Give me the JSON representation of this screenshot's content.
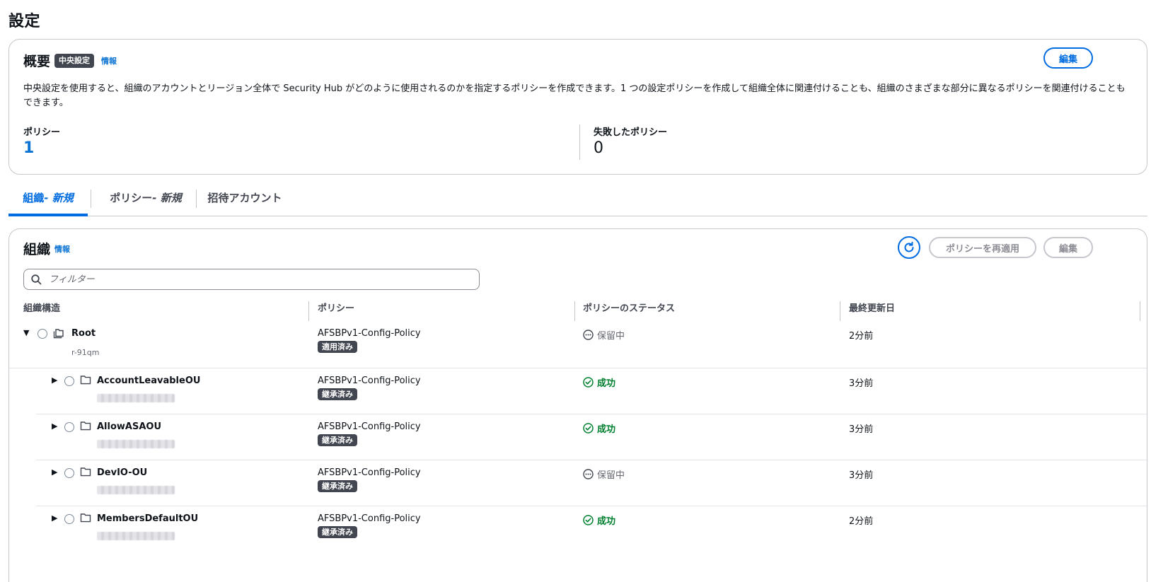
{
  "page": {
    "title": "設定"
  },
  "overview": {
    "title": "概要",
    "badge": "中央設定",
    "info": "情報",
    "edit_label": "編集",
    "description": "中央設定を使用すると、組織のアカウントとリージョン全体で Security Hub がどのように使用されるのかを指定するポリシーを作成できます。1 つの設定ポリシーを作成して組織全体に関連付けることも、組織のさまざまな部分に異なるポリシーを関連付けることもできます。",
    "metrics": [
      {
        "label": "ポリシー",
        "value": "1"
      },
      {
        "label": "失敗したポリシー",
        "value": "0"
      }
    ]
  },
  "tabs": [
    {
      "label": "組織",
      "suffix": "- 新規"
    },
    {
      "label": "ポリシー",
      "suffix": "- 新規"
    },
    {
      "label": "招待アカウント",
      "suffix": ""
    }
  ],
  "org": {
    "title": "組織",
    "info": "情報",
    "reapply_label": "ポリシーを再適用",
    "edit_label": "編集",
    "filter_placeholder": "フィルター",
    "columns": [
      "組織構造",
      "ポリシー",
      "ポリシーのステータス",
      "最終更新日"
    ],
    "rows": [
      {
        "name": "Root",
        "sub": "r-91qm",
        "policy": "AFSBPv1-Config-Policy",
        "tag": "適用済み",
        "status": "保留中",
        "status_kind": "pending",
        "updated": "2分前",
        "expanded": "▼",
        "icon": "org-units-icon"
      },
      {
        "name": "AccountLeavableOU",
        "sub": "",
        "policy": "AFSBPv1-Config-Policy",
        "tag": "継承済み",
        "status": "成功",
        "status_kind": "success",
        "updated": "3分前",
        "expanded": "▶",
        "icon": "folder-icon"
      },
      {
        "name": "AllowASAOU",
        "sub": "",
        "policy": "AFSBPv1-Config-Policy",
        "tag": "継承済み",
        "status": "成功",
        "status_kind": "success",
        "updated": "3分前",
        "expanded": "▶",
        "icon": "folder-icon"
      },
      {
        "name": "DevIO-OU",
        "sub": "",
        "policy": "AFSBPv1-Config-Policy",
        "tag": "継承済み",
        "status": "保留中",
        "status_kind": "pending",
        "updated": "3分前",
        "expanded": "▶",
        "icon": "folder-icon"
      },
      {
        "name": "MembersDefaultOU",
        "sub": "",
        "policy": "AFSBPv1-Config-Policy",
        "tag": "継承済み",
        "status": "成功",
        "status_kind": "success",
        "updated": "2分前",
        "expanded": "▶",
        "icon": "folder-icon"
      }
    ]
  },
  "colors": {
    "accent": "#006ce0",
    "success": "#00802f",
    "badge": "#424650"
  }
}
